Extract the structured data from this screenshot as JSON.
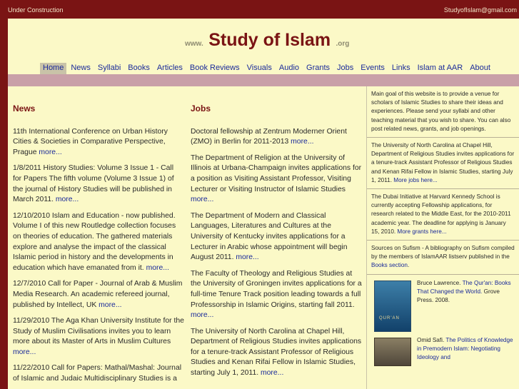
{
  "topbar": {
    "left": "Under Construction",
    "right": "StudyofIslam@gmail.com"
  },
  "logo": {
    "www": "www.",
    "title": "Study of Islam",
    "org": ".org"
  },
  "nav": [
    "Home",
    "News",
    "Syllabi",
    "Books",
    "Articles",
    "Book Reviews",
    "Visuals",
    "Audio",
    "Grants",
    "Jobs",
    "Events",
    "Links",
    "Islam at AAR",
    "About"
  ],
  "news": {
    "heading": "News",
    "items": [
      {
        "text": "11th International Conference on Urban History Cities & Societies in Comparative Perspective, Prague ",
        "more": "more..."
      },
      {
        "text": "1/8/2011 History Studies: Volume 3 Issue 1 - Call for Papers The fifth volume (Volume 3 Issue 1) of the journal of History Studies will be published in March 2011. ",
        "more": "more..."
      },
      {
        "text": "12/10/2010 Islam and Education - now published. Volume I of this new Routledge collection focuses on theories of education. The gathered materials explore and analyse the impact of the classical Islamic period in history and the developments in education which have emanated from it. ",
        "more": "more..."
      },
      {
        "text": "12/7/2010 Call for Paper - Journal of Arab & Muslim Media Research. An academic refereed journal, published by Intellect, UK ",
        "more": "more..."
      },
      {
        "text": "11/29/2010 The Aga Khan University Institute for the Study of Muslim Civilisations invites you to learn more about its Master of Arts in Muslim Cultures ",
        "more": "more..."
      },
      {
        "text": "11/22/2010 Call for Papers: Mathal/Mashal: Journal of Islamic and Judaic Multidisciplinary Studies is a",
        "more": ""
      }
    ]
  },
  "jobs": {
    "heading": "Jobs",
    "items": [
      {
        "text": "Doctoral fellowship at Zentrum Moderner Orient (ZMO) in Berlin for 2011-2013 ",
        "more": "more..."
      },
      {
        "text": "The Department of Religion at the University of Illinois at Urbana-Champaign invites applications for a position as Visiting Assistant Professor, Visiting Lecturer or Visiting Instructor of Islamic Studies ",
        "more": "more..."
      },
      {
        "text": "The Department of Modern and Classical Languages, Literatures and Cultures at the University of Kentucky invites applications for a Lecturer in Arabic whose appointment will begin August 2011. ",
        "more": "more..."
      },
      {
        "text": "The Faculty of Theology and Religious Studies at the University of Groningen invites applications for a full-time Tenure Track position leading towards a full Professorship in Islamic Origins, starting fall 2011. ",
        "more": "more..."
      },
      {
        "text": "The University of North Carolina at Chapel Hill, Department of Religious Studies invites applications for a tenure-track Assistant Professor of Religious Studies and Kenan Rifai Fellow in Islamic Studies, starting July 1, 2011. ",
        "more": "more..."
      }
    ]
  },
  "sidebar": {
    "intro": "Main goal of this website is to provide a venue for scholars of Islamic Studies to share their ideas and experiences. Please send your syllabi and other teaching material that you wish to share. You can also post related news, grants, and job openings.",
    "job": {
      "text": "The University of North Carolina at Chapel Hill, Department of Religious Studies invites applications for a tenure-track Assistant Professor of Religious Studies and Kenan Rifai Fellow in Islamic Studies, starting July 1, 2011. ",
      "more": "More jobs here..."
    },
    "grant": {
      "text": "The Dubai Initiative at Harvard Kennedy School is currently accepting Fellowship applications, for research related to the Middle East, for the 2010-2011 academic year. The deadline for applying is January 15, 2010. ",
      "more": "More grants here..."
    },
    "sufism": {
      "text": "Sources on Sufism - A bibliography on Sufism compiled by the members of IslamAAR listserv published in the ",
      "link": "Books section",
      "tail": "."
    },
    "book1": {
      "author": "Bruce Lawrence. ",
      "title": "The Qur'an: Books That Changed the World.",
      "pub": " Grove Press. 2008.",
      "cover": "QUR'AN"
    },
    "book2": {
      "author": "Omid Safi. ",
      "title": "The Politics of Knowledge in Premodern Islam: Negotiating Ideology and"
    }
  }
}
